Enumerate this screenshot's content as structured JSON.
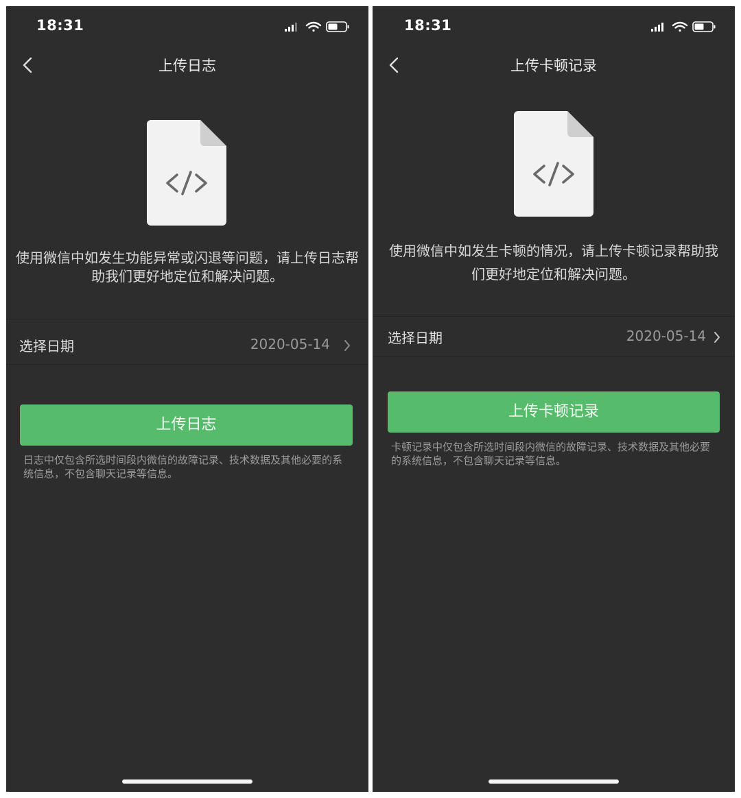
{
  "screens": [
    {
      "status_time": "18:31",
      "nav_title": "上传日志",
      "description": "使用微信中如发生功能异常或闪退等问题，请上传日志帮助我们更好地定位和解决问题。",
      "row_label": "选择日期",
      "row_value": "2020-05-14",
      "button_label": "上传日志",
      "note": "日志中仅包含所选时间段内微信的故障记录、技术数据及其他必要的系统信息，不包含聊天记录等信息。",
      "doc_icon": "code-file-icon"
    },
    {
      "status_time": "18:31",
      "nav_title": "上传卡顿记录",
      "description": "使用微信中如发生卡顿的情况，请上传卡顿记录帮助我们更好地定位和解决问题。",
      "row_label": "选择日期",
      "row_value": "2020-05-14",
      "button_label": "上传卡顿记录",
      "note": "卡顿记录中仅包含所选时间段内微信的故障记录、技术数据及其他必要的系统信息，不包含聊天记录等信息。",
      "doc_icon": "code-file-icon"
    }
  ],
  "colors": {
    "background": "#2d2d2d",
    "accent_green": "#56bb6b",
    "doc_icon": "#f2f2f2"
  }
}
